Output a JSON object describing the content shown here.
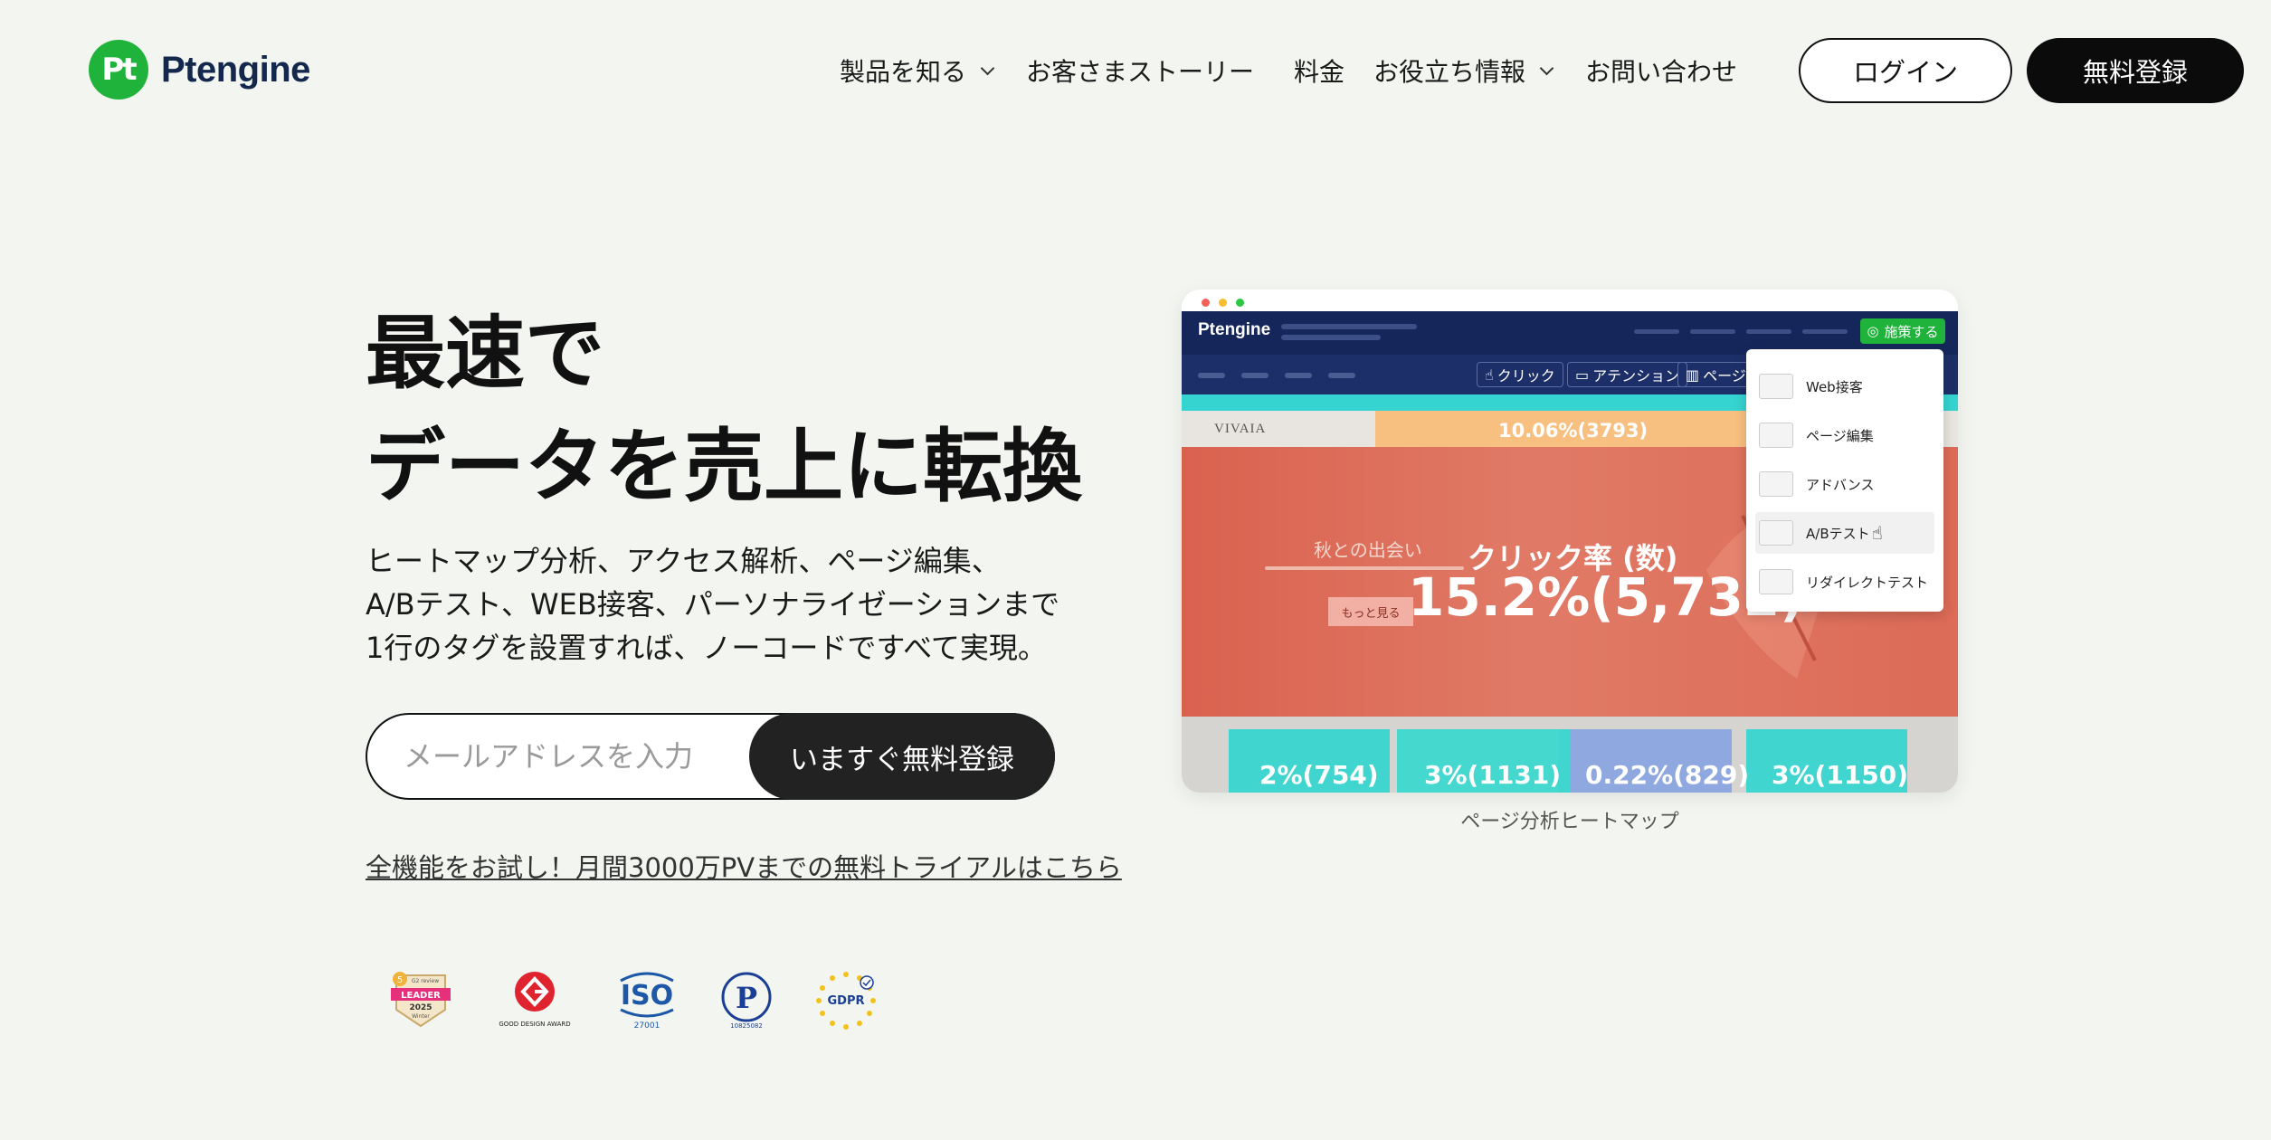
{
  "header": {
    "brand": "Ptengine",
    "logo_mark": "Pt",
    "nav": [
      {
        "label": "製品を知る",
        "dropdown": true
      },
      {
        "label": "お客さまストーリー",
        "dropdown": false
      },
      {
        "label": "料金",
        "dropdown": false
      },
      {
        "label": "お役立ち情報",
        "dropdown": true
      },
      {
        "label": "お問い合わせ",
        "dropdown": false
      }
    ],
    "login_label": "ログイン",
    "signup_label": "無料登録"
  },
  "hero": {
    "title_line1": "最速で",
    "title_line2": "データを売上に転換",
    "desc_line1": "ヒートマップ分析、アクセス解析、ページ編集、",
    "desc_line2": "A/Bテスト、WEB接客、パーソナライゼーションまで",
    "desc_line3": "1行のタグを設置すれば、ノーコードですべて実現。",
    "email_placeholder": "メールアドレスを入力",
    "email_button": "いますぐ無料登録",
    "trial_link": "全機能をお試し！月間3000万PVまでの無料トライアルはこちら"
  },
  "badges": [
    {
      "name": "g2-leader-badge",
      "label": "LEADER",
      "year": "2025",
      "top": "G2 review",
      "bottom": "Winter"
    },
    {
      "name": "good-design-award-badge",
      "label": "GOOD DESIGN AWARD"
    },
    {
      "name": "iso-27001-badge",
      "label": "ISO",
      "sub": "27001"
    },
    {
      "name": "privacy-mark-badge",
      "label": "P",
      "sub": "10825082"
    },
    {
      "name": "gdpr-badge",
      "label": "GDPR"
    }
  ],
  "product_shot": {
    "app_logo": "Ptengine",
    "action_button": "施策する",
    "tabs": [
      "クリック",
      "アテンション",
      "ページ"
    ],
    "site_logo": "VIVAIA",
    "top_metric": "10.06%(3793)",
    "image_copy": "秋との出会い",
    "more_button": "もっと見る",
    "metric_label": "クリック率 (数)",
    "metric_value": "15.2%(5,732)",
    "cards": [
      "2%(754)",
      "3%(1131)",
      "0.22%(829)",
      "3%(1150)"
    ],
    "menu": [
      "Web接客",
      "ページ編集",
      "アドバンス",
      "A/Bテスト",
      "リダイレクトテスト"
    ],
    "caption": "ページ分析ヒートマップ"
  },
  "colors": {
    "brand_green": "#1fb33c",
    "brand_navy": "#13284c",
    "background": "#f2f5f0",
    "dark_button": "#0b0b0b"
  }
}
